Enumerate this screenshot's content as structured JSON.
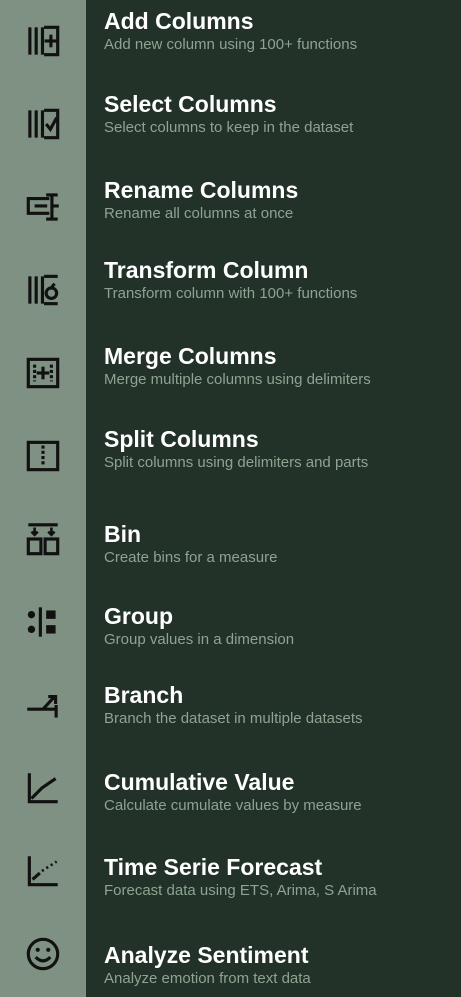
{
  "menu": {
    "items": [
      {
        "title": "Add Columns",
        "description": "Add new column using 100+ functions",
        "icon": "add-columns-icon"
      },
      {
        "title": "Select Columns",
        "description": "Select columns to keep in the dataset",
        "icon": "select-columns-icon"
      },
      {
        "title": "Rename Columns",
        "description": "Rename all columns at once",
        "icon": "rename-columns-icon"
      },
      {
        "title": "Transform Column",
        "description": "Transform column with 100+ functions",
        "icon": "transform-column-icon"
      },
      {
        "title": "Merge Columns",
        "description": "Merge multiple columns using delimiters",
        "icon": "merge-columns-icon"
      },
      {
        "title": "Split Columns",
        "description": "Split columns using delimiters and parts",
        "icon": "split-columns-icon"
      },
      {
        "title": "Bin",
        "description": "Create bins for a measure",
        "icon": "bin-icon"
      },
      {
        "title": "Group",
        "description": "Group values in a dimension",
        "icon": "group-icon"
      },
      {
        "title": "Branch",
        "description": "Branch the dataset in multiple datasets",
        "icon": "branch-icon"
      },
      {
        "title": "Cumulative Value",
        "description": "Calculate cumulate values by measure",
        "icon": "cumulative-value-icon"
      },
      {
        "title": "Time Serie Forecast",
        "description": "Forecast data using ETS, Arima, S Arima",
        "icon": "time-series-forecast-icon"
      },
      {
        "title": "Analyze Sentiment",
        "description": "Analyze emotion from text data",
        "icon": "smiley-face-icon"
      }
    ]
  },
  "colors": {
    "rail": "#7f9182",
    "panel": "#223229",
    "title": "#ffffff",
    "description": "#8ea391",
    "icon": "#111111"
  }
}
